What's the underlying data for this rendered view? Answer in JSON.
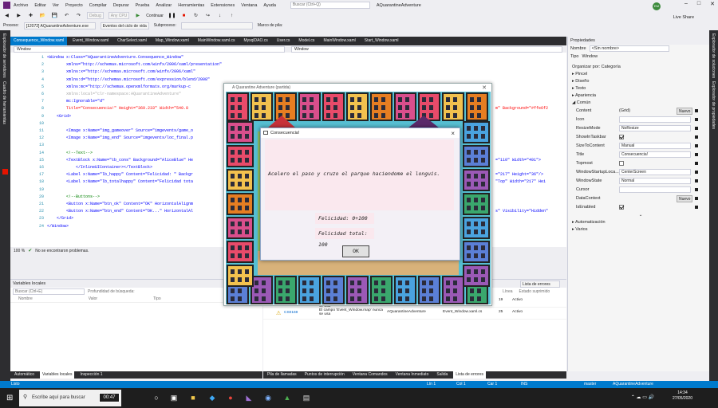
{
  "menubar": {
    "items": [
      "Archivo",
      "Editar",
      "Ver",
      "Proyecto",
      "Compilar",
      "Depurar",
      "Prueba",
      "Analizar",
      "Herramientas",
      "Extensiones",
      "Ventana",
      "Ayuda"
    ],
    "search_placeholder": "Buscar (Ctrl+Q)",
    "app_title": "AQuarantineAdventure",
    "avatar_initials": "EM"
  },
  "toolbar": {
    "config": "Debug",
    "platform": "Any CPU",
    "continue_label": "Continuar",
    "live_share": "Live Share",
    "process_label": "Proceso:",
    "process_value": "[12072] AQuarantineAdventure.exe",
    "lifecycle_label": "Eventos del ciclo de vida",
    "thread_label": "Subproceso:",
    "stack_label": "Marco de pila:"
  },
  "left_strip": [
    "Explorador de servidores",
    "Cuadro de herramientas"
  ],
  "right_strip": [
    "Explorador de soluciones",
    "Explorador de propiedades"
  ],
  "tabs": [
    "Consequence_Window.xaml",
    "Event_Window.xaml",
    "CharSelect.xaml",
    "Map_Window.xaml",
    "MainWindow.xaml.cs",
    "MysqlDAO.cs",
    "User.cs",
    "Model.cs",
    "MainWindow.xaml",
    "Start_Window.xaml"
  ],
  "nav": {
    "left": "Window",
    "right": "Window"
  },
  "code_lines": [
    {
      "n": "1",
      "t": "<Window x:Class=\"AQuarantineAdventure.Consequence_Window\""
    },
    {
      "n": "2",
      "t": "        xmlns=\"http://schemas.microsoft.com/winfx/2006/xaml/presentation\""
    },
    {
      "n": "3",
      "t": "        xmlns:x=\"http://schemas.microsoft.com/winfx/2006/xaml\""
    },
    {
      "n": "4",
      "t": "        xmlns:d=\"http://schemas.microsoft.com/expression/blend/2008\""
    },
    {
      "n": "5",
      "t": "        xmlns:mc=\"http://schemas.openxmlformats.org/markup-c"
    },
    {
      "n": "6",
      "t": "        xmlns:local=\"clr-namespace:AQuarantineAdventure\""
    },
    {
      "n": "7",
      "t": "        mc:Ignorable=\"d\""
    },
    {
      "n": "8",
      "t": "        Title=\"Consecuencia!\" Height=\"369.233\" Width=\"540.8"
    },
    {
      "n": "9",
      "t": "    <Grid>"
    },
    {
      "n": "10",
      "t": ""
    },
    {
      "n": "11",
      "t": "        <Image x:Name=\"img_gameover\" Source=\"imgevents/game_o"
    },
    {
      "n": "12",
      "t": "        <Image x:Name=\"img_end\" Source=\"imgevents/loc_final.p"
    },
    {
      "n": "13",
      "t": ""
    },
    {
      "n": "14",
      "t": "        <!--Text-->"
    },
    {
      "n": "15",
      "t": "        <TextBlock x:Name=\"tb_cons\" Background=\"AliceBlue\" He"
    },
    {
      "n": "16",
      "t": "            </InlineUIContainer></TextBlock>"
    },
    {
      "n": "17",
      "t": "        <Label x:Name=\"lb_happy\" Content=\"Felicidad: \" Backgr"
    },
    {
      "n": "18",
      "t": "        <Label x:Name=\"lb_totalhappy\" Content=\"Felicidad tota"
    },
    {
      "n": "19",
      "t": ""
    },
    {
      "n": "20",
      "t": "        <!--Buttons-->"
    },
    {
      "n": "21",
      "t": "        <Button x:Name=\"btn_ok\" Content=\"OK\" HorizontalAlignm"
    },
    {
      "n": "22",
      "t": "        <Button x:Name=\"btn_end\" Content=\"OK...\" HorizontalAl"
    },
    {
      "n": "23",
      "t": "    </Grid>"
    },
    {
      "n": "24",
      "t": "</Window>"
    }
  ],
  "code_right": [
    {
      "row": 8,
      "t": "m\" Background=\"#ffe6f2"
    },
    {
      "row": 15,
      "t": "=\"110\" Width=\"491\">"
    },
    {
      "row": 17,
      "t": "=\"217\" Height=\"36\"/>"
    },
    {
      "row": 18,
      "t": "\"Top\" Width=\"217\" Hei"
    },
    {
      "row": 22,
      "t": "s\" Visibility=\"Hidden\""
    }
  ],
  "editor_status": {
    "zoom": "100 %",
    "message": "No se encontraron problemas."
  },
  "locals": {
    "title": "Variables locales",
    "search_placeholder": "Buscar (Ctrl+E)",
    "depth_label": "Profundidad de búsqueda:",
    "columns": [
      "Nombre",
      "Valor",
      "Tipo"
    ]
  },
  "errors": {
    "filter": "Lista de errores",
    "columns": [
      "Línea",
      "Estado suprimido"
    ],
    "rows": [
      {
        "code": "CS0169",
        "desc": "El campo 'Consequence_Window.cns' nunca se usa",
        "project": "AQuarantineAdventure",
        "file": "Consequence_Window.xa...",
        "line": "19",
        "state": "Activo"
      },
      {
        "code": "CS0169",
        "desc": "El campo 'Event_Window.map' nunca se usa",
        "project": "AQuarantineAdventure",
        "file": "Event_Window.xaml.cs",
        "line": "25",
        "state": "Activo"
      }
    ]
  },
  "bottom_tabs_left": [
    "Automático",
    "Variables locales",
    "Inspección 1"
  ],
  "bottom_tabs_right": [
    "Pila de llamadas",
    "Puntos de interrupción",
    "Ventana Comandos",
    "Ventana Inmediato",
    "Salida",
    "Lista de errores"
  ],
  "properties": {
    "title": "Propiedades",
    "name_label": "Nombre",
    "name_value": "<Sin nombre>",
    "type_label": "Tipo",
    "type_value": "Window",
    "arrange": "Organizar por: Categoría",
    "categories": [
      "Pincel",
      "Diseño",
      "Texto",
      "Apariencia",
      "Común"
    ],
    "rows": [
      {
        "label": "Content",
        "value": "(Grid)",
        "kind": "nuevo",
        "btn": "Nuevo"
      },
      {
        "label": "Icon",
        "value": "",
        "kind": "select"
      },
      {
        "label": "ResizeMode",
        "value": "NoResize",
        "kind": "select"
      },
      {
        "label": "ShowInTaskbar",
        "value": "",
        "kind": "check",
        "checked": true
      },
      {
        "label": "SizeToContent",
        "value": "Manual",
        "kind": "select"
      },
      {
        "label": "Title",
        "value": "Consecuencia!",
        "kind": "text"
      },
      {
        "label": "Topmost",
        "value": "",
        "kind": "check",
        "checked": false
      },
      {
        "label": "WindowStartupLoca...",
        "value": "CenterScreen",
        "kind": "select"
      },
      {
        "label": "WindowState",
        "value": "Normal",
        "kind": "select"
      },
      {
        "label": "Cursor",
        "value": "",
        "kind": "select"
      },
      {
        "label": "DataContext",
        "value": "",
        "kind": "nuevo",
        "btn": "Nuevo"
      },
      {
        "label": "IsEnabled",
        "value": "",
        "kind": "check",
        "checked": true
      }
    ],
    "categories_after": [
      "Automatización",
      "Varios"
    ]
  },
  "statusbar": {
    "left": "Listo",
    "ln": "Lín 1",
    "col": "Col 1",
    "car": "Car 1",
    "mode": "INS",
    "branch": "master",
    "repo": "AQuarantineAdventure"
  },
  "taskbar": {
    "search_placeholder": "Escribe aquí para buscar",
    "timer": "00:47",
    "time": "14:34",
    "date": "27/05/2020"
  },
  "game": {
    "title": "A Quarantine Adventure (partida)"
  },
  "dialog": {
    "title": "Consecuencia!",
    "message": "Acelero el paso y cruzo el parque haciendome el longuis.",
    "happy": "Felicidad: 0+100",
    "total": "Felicidad total: 100",
    "ok": "OK"
  },
  "colors": {
    "accent": "#007acc",
    "dark": "#2d2d30",
    "dialog_bg": "#fae8ee"
  }
}
